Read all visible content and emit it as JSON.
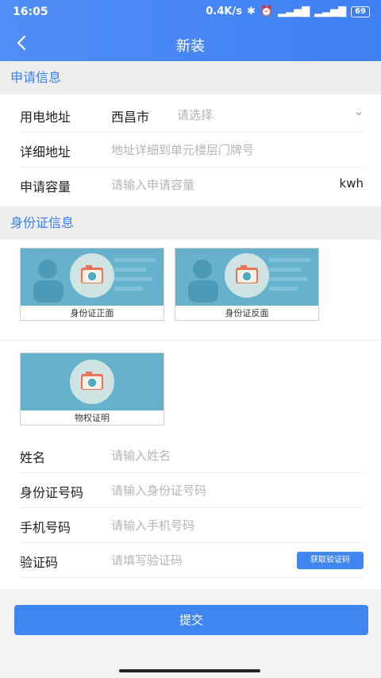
{
  "status": {
    "time": "16:05",
    "net": "0.4K/s",
    "battery": "69"
  },
  "header": {
    "title": "新装"
  },
  "sections": {
    "apply": "申请信息",
    "id": "身份证信息"
  },
  "apply": {
    "address_label": "用电地址",
    "city": "西昌市",
    "address_placeholder": "请选择",
    "detail_label": "详细地址",
    "detail_placeholder": "地址详细到单元楼层门牌号",
    "capacity_label": "申请容量",
    "capacity_placeholder": "请输入申请容量",
    "capacity_unit": "kwh"
  },
  "uploads": {
    "front": "身份证正面",
    "back": "身份证反面",
    "property": "物权证明"
  },
  "person": {
    "name_label": "姓名",
    "name_placeholder": "请输入姓名",
    "idno_label": "身份证号码",
    "idno_placeholder": "请输入身份证号码",
    "phone_label": "手机号码",
    "phone_placeholder": "请输入手机号码",
    "code_label": "验证码",
    "code_placeholder": "请填写验证码",
    "code_button": "获取验证码"
  },
  "submit": "提交",
  "colors": {
    "accent": "#3f86f0",
    "card_bg": "#66b1cc"
  }
}
